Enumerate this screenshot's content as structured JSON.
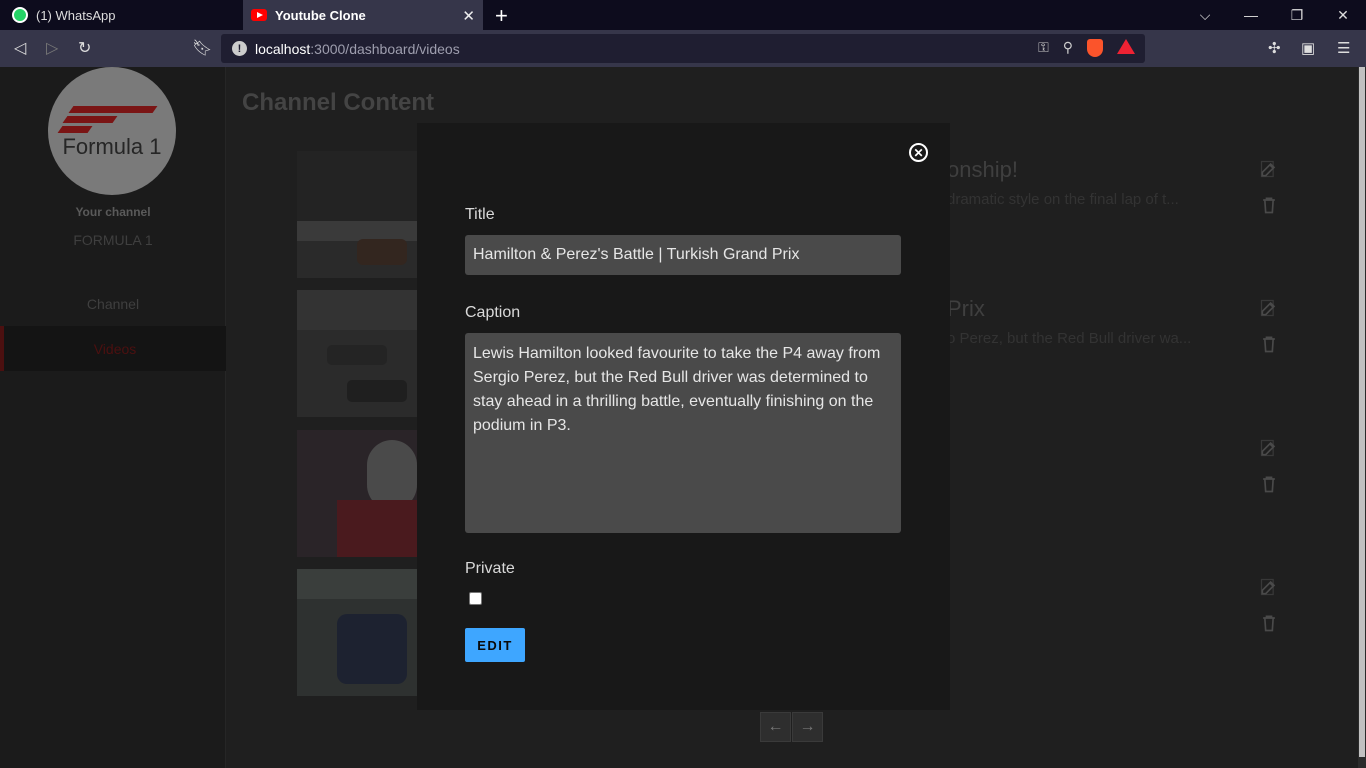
{
  "browser": {
    "tabs": [
      {
        "label": "(1) WhatsApp",
        "icon": "whatsapp-icon"
      },
      {
        "label": "Youtube Clone",
        "icon": "youtube-icon"
      }
    ],
    "new_tab": "+",
    "url_host": "localhost",
    "url_path": ":3000/dashboard/videos"
  },
  "sidebar": {
    "avatar_text": "Formula 1",
    "your_channel": "Your channel",
    "channel_name": "FORMULA 1",
    "items": [
      {
        "label": "Channel"
      },
      {
        "label": "Videos",
        "active": true
      }
    ]
  },
  "main": {
    "title": "Channel Content",
    "videos": [
      {
        "title_fragment": "onship!",
        "desc_fragment": "dramatic style on the final lap of t..."
      },
      {
        "title_fragment": "Prix",
        "desc_fragment": "o Perez, but the Red Bull driver wa..."
      },
      {
        "title_fragment": "",
        "desc_fragment": ""
      },
      {
        "title_fragment": "",
        "desc_fragment": ""
      }
    ],
    "pager": {
      "prev": "←",
      "next": "→"
    }
  },
  "modal": {
    "title_label": "Title",
    "title_value": "Hamilton & Perez's Battle | Turkish Grand Prix",
    "caption_label": "Caption",
    "caption_lines": [
      "Lewis Hamilton looked favourite to take the P4 away from",
      "Sergio Perez, but the Red Bull driver was determined to",
      "stay ahead in a thrilling battle, eventually finishing on the",
      "podium in P3."
    ],
    "private_label": "Private",
    "private_checked": false,
    "submit_label": "EDIT"
  },
  "colors": {
    "accent": "#3ea6ff",
    "active_nav": "#4c1010",
    "brand_red": "#e10600"
  }
}
